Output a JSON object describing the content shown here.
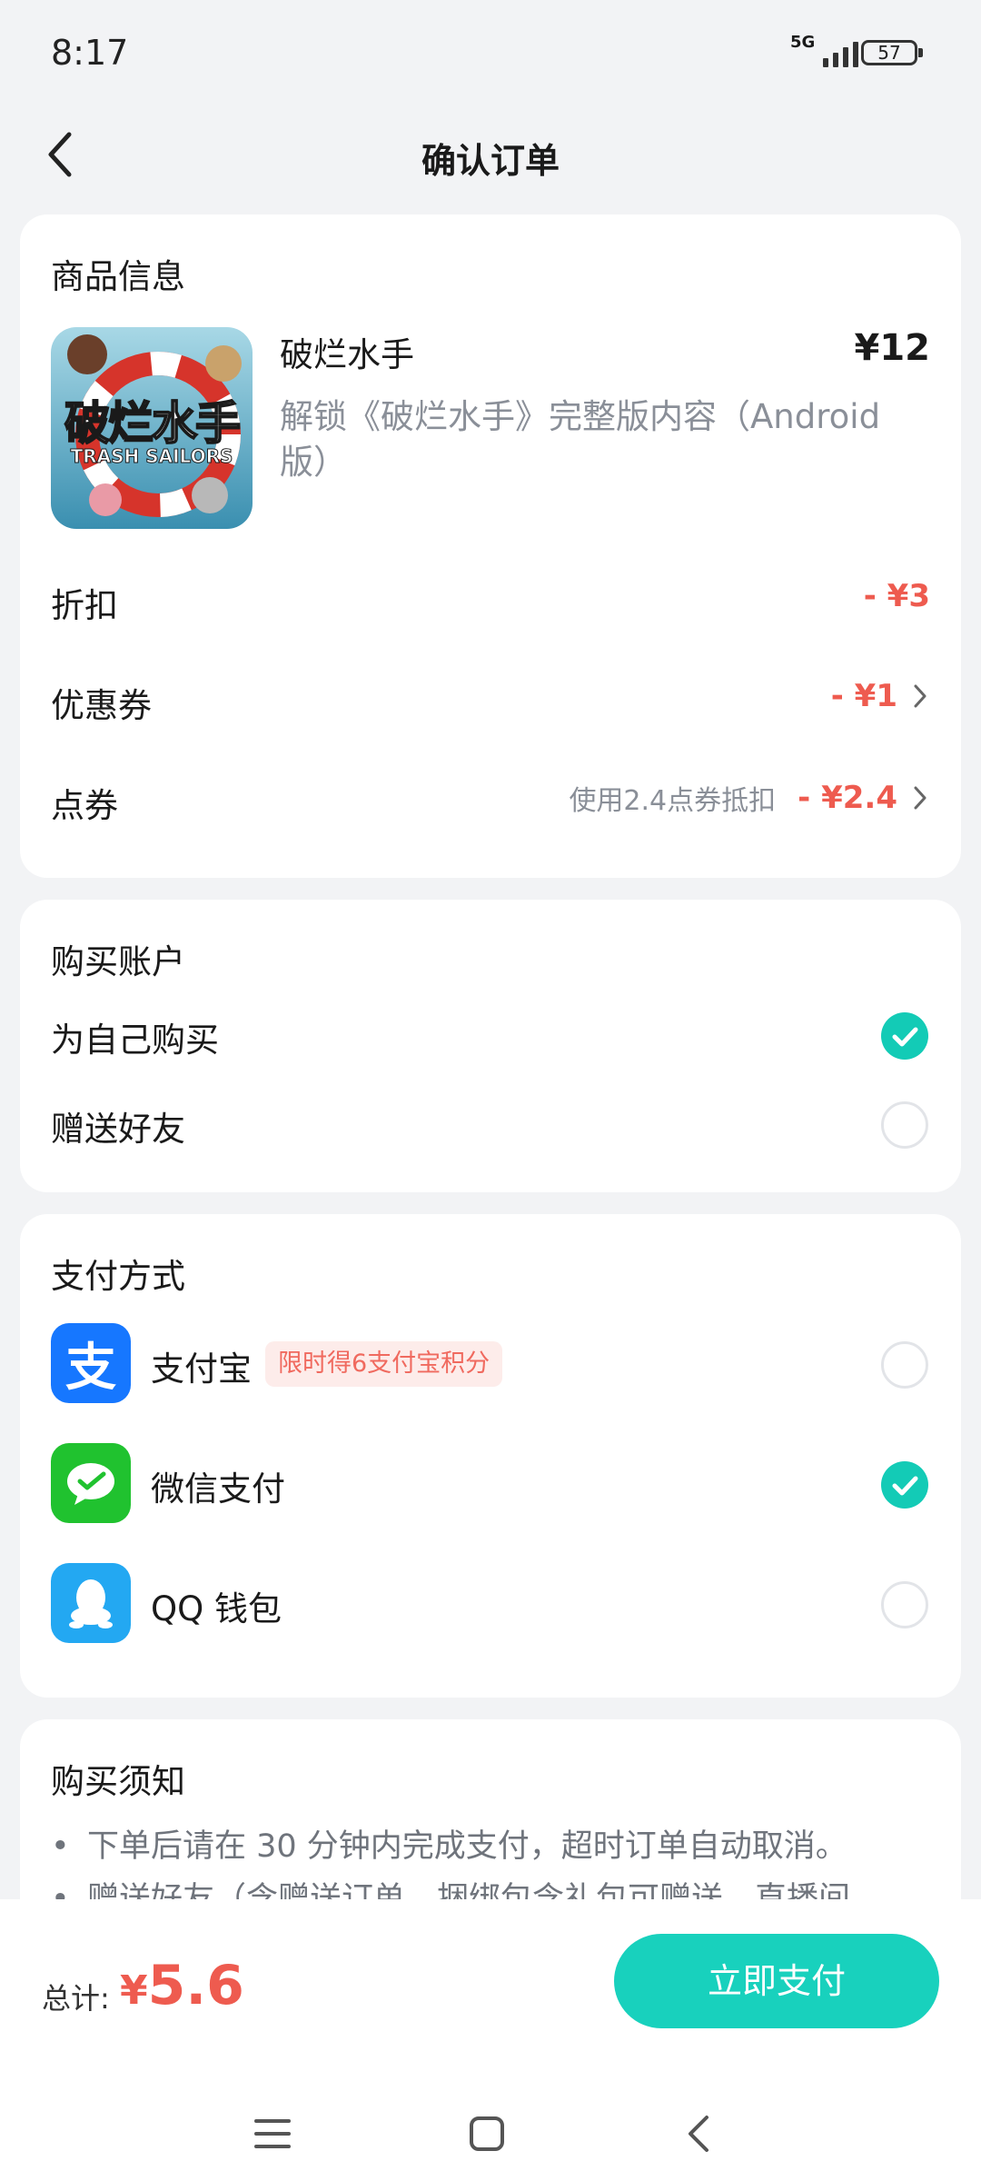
{
  "status": {
    "time": "8:17",
    "network": "5G",
    "battery": "57"
  },
  "header": {
    "title": "确认订单"
  },
  "product_card": {
    "title": "商品信息",
    "thumb_title": "破烂水手",
    "thumb_subtitle": "TRASH SAILORS",
    "name": "破烂水手",
    "price": "¥12",
    "description": "解锁《破烂水手》完整版内容（Android版）",
    "discount": {
      "label": "折扣",
      "value": "- ¥3"
    },
    "coupon": {
      "label": "优惠券",
      "value": "- ¥1"
    },
    "points": {
      "label": "点券",
      "hint": "使用2.4点券抵扣",
      "value": "- ¥2.4"
    }
  },
  "account_card": {
    "title": "购买账户",
    "options": [
      {
        "label": "为自己购买",
        "selected": true
      },
      {
        "label": "赠送好友",
        "selected": false
      }
    ]
  },
  "payment_card": {
    "title": "支付方式",
    "methods": [
      {
        "label": "支付宝",
        "promo": "限时得6支付宝积分",
        "icon": "alipay-icon",
        "selected": false
      },
      {
        "label": "微信支付",
        "icon": "wechat-pay-icon",
        "selected": true
      },
      {
        "label": "QQ 钱包",
        "icon": "qq-wallet-icon",
        "selected": false
      }
    ]
  },
  "notice_card": {
    "title": "购买须知",
    "items": [
      "下单后请在 30 分钟内完成支付，超时订单自动取消。",
      "赠送好友（含赠送订单、捆绑包含礼包可赠送，直播间"
    ]
  },
  "footer": {
    "total_label": "总计:",
    "currency": "¥",
    "total": "5.6",
    "pay_button": "立即支付"
  },
  "colors": {
    "accent": "#18d1bd",
    "price_red": "#ee5b4f"
  }
}
